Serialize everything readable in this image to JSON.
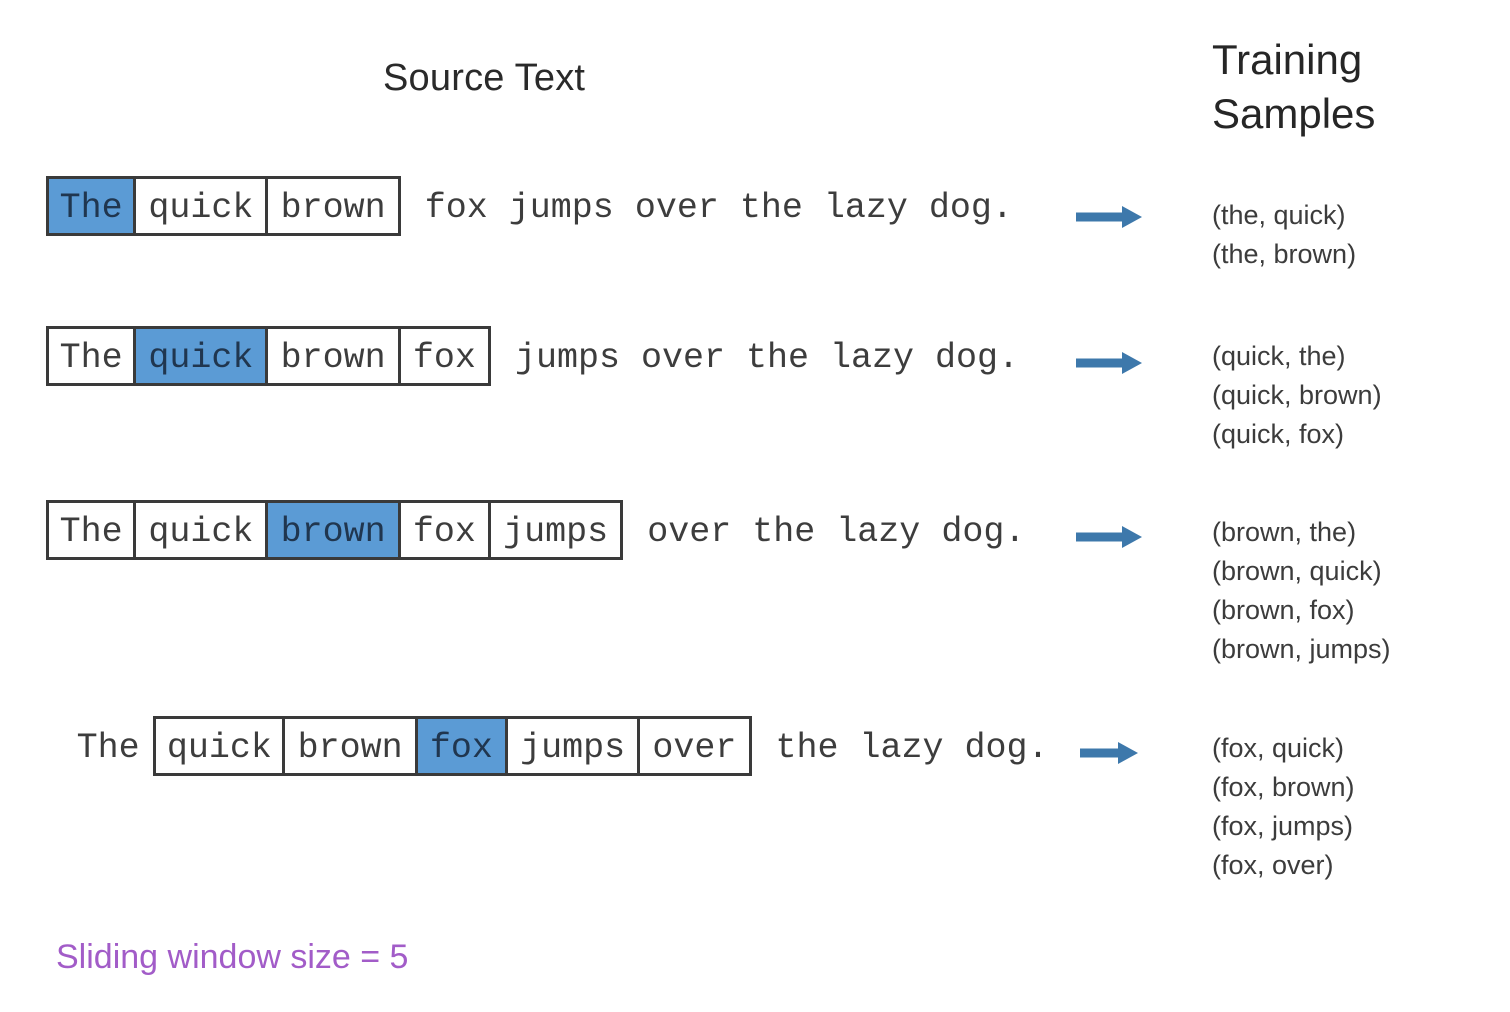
{
  "headings": {
    "source_text": "Source Text",
    "training_samples_line1": "Training",
    "training_samples_line2": "Samples"
  },
  "caption": {
    "text": "Sliding window size = 5",
    "color": "#a25cc8"
  },
  "colors": {
    "highlight": "#5b9bd5",
    "box_border": "#3a3a3a",
    "arrow": "#3d78ab",
    "text": "#3d3d3d"
  },
  "sentence": "The quick brown fox jumps over the lazy dog.",
  "rows": [
    {
      "id": "row-1",
      "target_word": "The",
      "window_words": [
        "The",
        "quick",
        "brown"
      ],
      "cells": [
        {
          "text": "The",
          "boxed": true,
          "highlighted": true
        },
        {
          "text": "quick",
          "boxed": true,
          "highlighted": false
        },
        {
          "text": "brown",
          "boxed": true,
          "highlighted": false
        }
      ],
      "leading": "",
      "trailing": " fox jumps over the lazy dog.",
      "arrow_icon": "right-arrow-icon",
      "samples": [
        "(the, quick)",
        "(the, brown)"
      ]
    },
    {
      "id": "row-2",
      "target_word": "quick",
      "window_words": [
        "The",
        "quick",
        "brown",
        "fox"
      ],
      "cells": [
        {
          "text": "The",
          "boxed": true,
          "highlighted": false
        },
        {
          "text": "quick",
          "boxed": true,
          "highlighted": true
        },
        {
          "text": "brown",
          "boxed": true,
          "highlighted": false
        },
        {
          "text": "fox",
          "boxed": true,
          "highlighted": false
        }
      ],
      "leading": "",
      "trailing": " jumps over the lazy dog.",
      "arrow_icon": "right-arrow-icon",
      "samples": [
        "(quick, the)",
        "(quick, brown)",
        "(quick, fox)"
      ]
    },
    {
      "id": "row-3",
      "target_word": "brown",
      "window_words": [
        "The",
        "quick",
        "brown",
        "fox",
        "jumps"
      ],
      "cells": [
        {
          "text": "The",
          "boxed": true,
          "highlighted": false
        },
        {
          "text": "quick",
          "boxed": true,
          "highlighted": false
        },
        {
          "text": "brown",
          "boxed": true,
          "highlighted": true
        },
        {
          "text": "fox",
          "boxed": true,
          "highlighted": false
        },
        {
          "text": "jumps",
          "boxed": true,
          "highlighted": false
        }
      ],
      "leading": "",
      "trailing": " over the lazy dog.",
      "arrow_icon": "right-arrow-icon",
      "samples": [
        "(brown, the)",
        "(brown, quick)",
        "(brown, fox)",
        "(brown, jumps)"
      ]
    },
    {
      "id": "row-4",
      "target_word": "fox",
      "window_words": [
        "quick",
        "brown",
        "fox",
        "jumps",
        "over"
      ],
      "cells": [
        {
          "text": "The",
          "boxed": false,
          "highlighted": false
        },
        {
          "text": "quick",
          "boxed": true,
          "highlighted": false
        },
        {
          "text": "brown",
          "boxed": true,
          "highlighted": false
        },
        {
          "text": "fox",
          "boxed": true,
          "highlighted": true
        },
        {
          "text": "jumps",
          "boxed": true,
          "highlighted": false
        },
        {
          "text": "over",
          "boxed": true,
          "highlighted": false
        }
      ],
      "leading": "",
      "trailing": " the lazy dog.",
      "arrow_icon": "right-arrow-icon",
      "samples": [
        "(fox, quick)",
        "(fox, brown)",
        "(fox, jumps)",
        "(fox, over)"
      ]
    }
  ]
}
